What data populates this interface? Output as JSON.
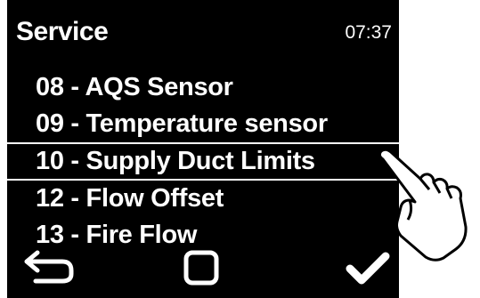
{
  "header": {
    "title": "Service",
    "time": "07:37"
  },
  "menu": {
    "items": [
      {
        "label": "08 - AQS Sensor"
      },
      {
        "label": "09 - Temperature sensor"
      },
      {
        "label": "10 - Supply Duct Limits"
      },
      {
        "label": "12 - Flow Offset"
      },
      {
        "label": "13 - Fire Flow"
      }
    ],
    "selected_index": 2
  },
  "footer": {
    "icons": [
      "back-arrow-icon",
      "home-square-icon",
      "checkmark-icon"
    ]
  },
  "overlay": {
    "icon": "pointing-hand-icon"
  },
  "colors": {
    "screen_bg": "#000000",
    "text": "#ffffff",
    "page_bg": "#ffffff"
  }
}
